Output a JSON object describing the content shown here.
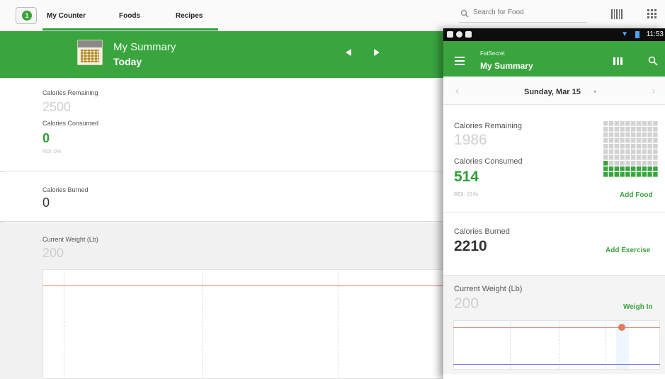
{
  "tablet": {
    "tabs": [
      "My Counter",
      "Foods",
      "Recipes"
    ],
    "search_placeholder": "Search for Food",
    "logo_glyph": "1",
    "header": {
      "title": "My Summary",
      "subtitle": "Today"
    },
    "calories_remaining": {
      "label": "Calories Remaining",
      "value": "2500"
    },
    "calories_consumed": {
      "label": "Calories Consumed",
      "value": "0",
      "rdi": "RDI: 0%"
    },
    "calories_burned": {
      "label": "Calories Burned",
      "value": "0"
    },
    "current_weight": {
      "label": "Current Weight (Lb)",
      "value": "200"
    }
  },
  "phone": {
    "status_time": "11:53",
    "app_name": "FatSecret",
    "title": "My Summary",
    "date": "Sunday, Mar 15",
    "calories_remaining": {
      "label": "Calories Remaining",
      "value": "1986"
    },
    "calories_consumed": {
      "label": "Calories Consumed",
      "value": "514",
      "rdi": "RDI: 21%"
    },
    "add_food": "Add Food",
    "calories_burned": {
      "label": "Calories Burned",
      "value": "2210"
    },
    "add_exercise": "Add Exercise",
    "current_weight": {
      "label": "Current Weight (Lb)",
      "value": "200"
    },
    "weigh_in": "Weigh In",
    "calorie_grid_fill_fraction": 0.21
  },
  "colors": {
    "brand_green": "#3aa53f",
    "value_green": "#2e9d37",
    "weight_line": "#e0836c"
  }
}
